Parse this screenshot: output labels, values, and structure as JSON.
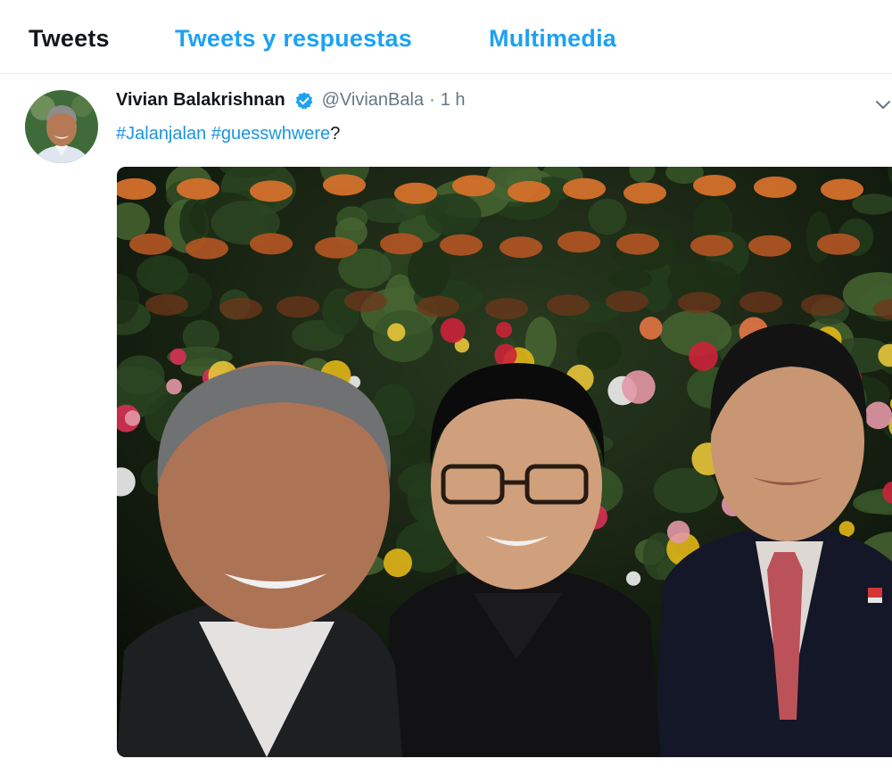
{
  "tabs": [
    {
      "label": "Tweets",
      "active": true
    },
    {
      "label": "Tweets y respuestas",
      "active": false
    },
    {
      "label": "Multimedia",
      "active": false
    }
  ],
  "tweet": {
    "display_name": "Vivian Balakrishnan",
    "verified": true,
    "handle": "@VivianBala",
    "separator": "·",
    "time": "1 h",
    "hashtag_1": "#Jalanjalan",
    "space": " ",
    "hashtag_2": "#guesswhwere",
    "suffix": "?",
    "avatar_icon": "profile-photo",
    "verified_icon": "verified-badge-icon",
    "menu_icon": "chevron-down-icon",
    "media_icon": "photo-selfie-three-men-flower-wall"
  },
  "colors": {
    "accent": "#1da1f2",
    "link": "#1b95e0",
    "text": "#14171a",
    "muted": "#657786",
    "divider": "#e6ecf0"
  }
}
